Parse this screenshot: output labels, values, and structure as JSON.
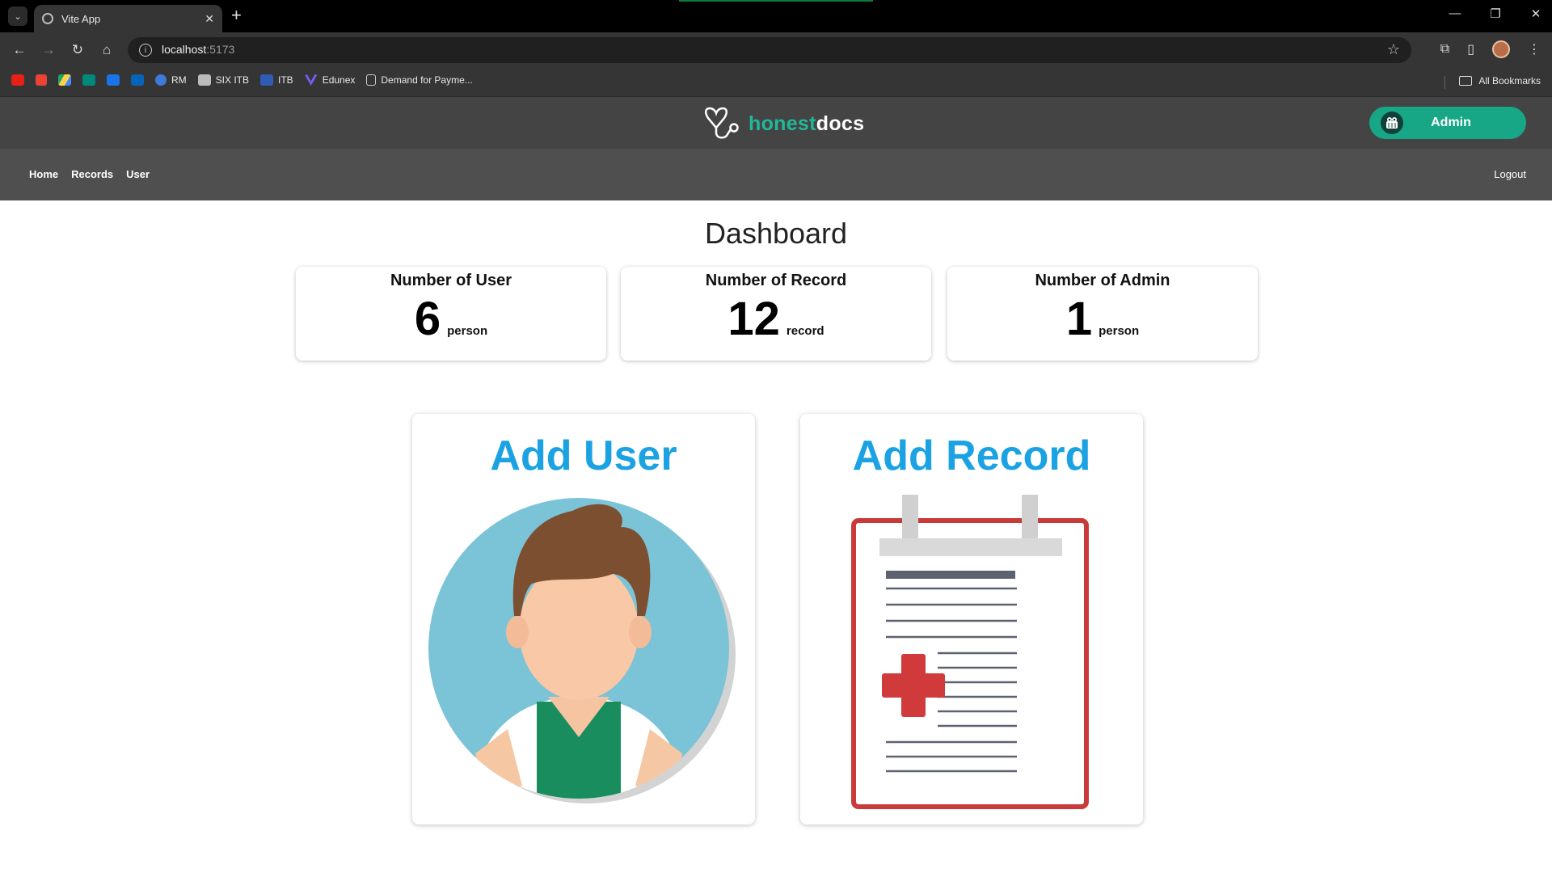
{
  "browser": {
    "tab_title": "Vite App",
    "url_host": "localhost",
    "url_port": ":5173",
    "bookmarks": [
      "RM",
      "SIX ITB",
      "ITB",
      "Edunex",
      "Demand for Payme..."
    ],
    "all_bookmarks": "All Bookmarks"
  },
  "header": {
    "logo_part1": "honest",
    "logo_part2": "docs",
    "admin_label": "Admin"
  },
  "nav": {
    "items": [
      "Home",
      "Records",
      "User"
    ],
    "logout": "Logout"
  },
  "dashboard": {
    "title": "Dashboard",
    "stats": [
      {
        "label": "Number of User",
        "value": "6",
        "unit": "person"
      },
      {
        "label": "Number of Record",
        "value": "12",
        "unit": "record"
      },
      {
        "label": "Number of Admin",
        "value": "1",
        "unit": "person"
      }
    ],
    "actions": [
      {
        "title": "Add User",
        "icon": "user-avatar-icon"
      },
      {
        "title": "Add Record",
        "icon": "medical-record-icon"
      }
    ]
  },
  "colors": {
    "accent": "#18a786",
    "action_title": "#1ba2e2",
    "header_bg": "#444444",
    "nav_bg": "#4f4f4f"
  }
}
